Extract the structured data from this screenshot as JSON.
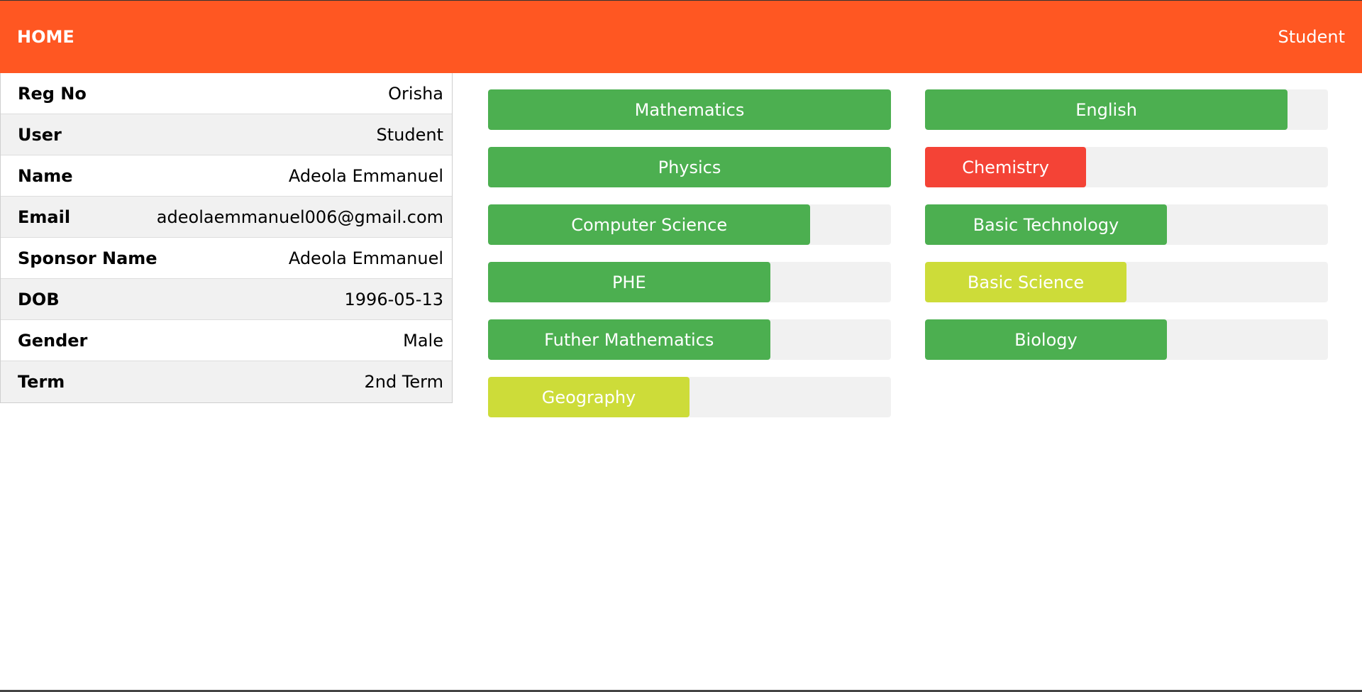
{
  "navbar": {
    "home_label": "HOME",
    "user_label": "Student",
    "color": "#ff5722"
  },
  "info": {
    "rows": [
      {
        "label": "Reg No",
        "value": "Orisha"
      },
      {
        "label": "User",
        "value": "Student"
      },
      {
        "label": "Name",
        "value": "Adeola Emmanuel"
      },
      {
        "label": "Email",
        "value": "adeolaemmanuel006@gmail.com"
      },
      {
        "label": "Sponsor Name",
        "value": "Adeola Emmanuel"
      },
      {
        "label": "DOB",
        "value": "1996-05-13"
      },
      {
        "label": "Gender",
        "value": "Male"
      },
      {
        "label": "Term",
        "value": "2nd Term"
      }
    ]
  },
  "subjects": {
    "items": [
      {
        "name": "Mathematics",
        "level": 1.0,
        "color": "#4caf50"
      },
      {
        "name": "English",
        "level": 0.9,
        "color": "#4caf50"
      },
      {
        "name": "Physics",
        "level": 1.0,
        "color": "#4caf50"
      },
      {
        "name": "Chemistry",
        "level": 0.4,
        "color": "#f44336"
      },
      {
        "name": "Computer Science",
        "level": 0.8,
        "color": "#4caf50"
      },
      {
        "name": "Basic Technology",
        "level": 0.6,
        "color": "#4caf50"
      },
      {
        "name": "PHE",
        "level": 0.7,
        "color": "#4caf50"
      },
      {
        "name": "Basic Science",
        "level": 0.5,
        "color": "#cddc39"
      },
      {
        "name": "Futher Mathematics",
        "level": 0.7,
        "color": "#4caf50"
      },
      {
        "name": "Biology",
        "level": 0.6,
        "color": "#4caf50"
      },
      {
        "name": "Geography",
        "level": 0.5,
        "color": "#cddc39"
      }
    ]
  }
}
